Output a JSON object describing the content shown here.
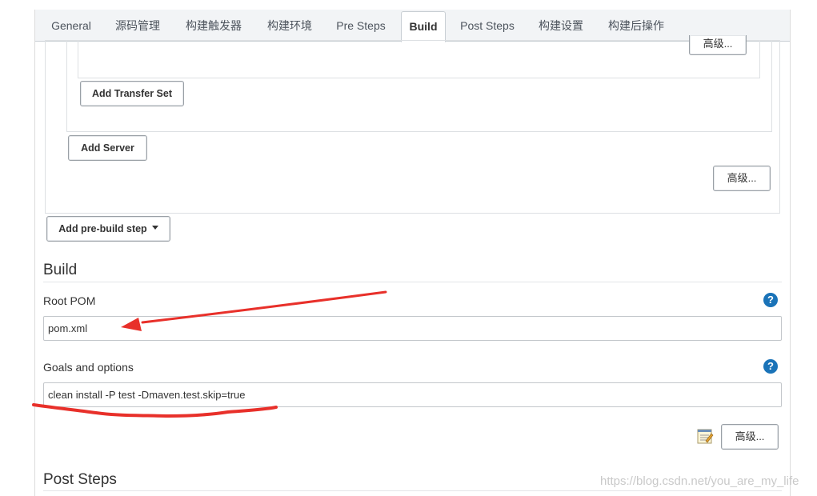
{
  "tabs": [
    {
      "label": "General"
    },
    {
      "label": "源码管理"
    },
    {
      "label": "构建触发器"
    },
    {
      "label": "构建环境"
    },
    {
      "label": "Pre Steps"
    },
    {
      "label": "Build"
    },
    {
      "label": "Post Steps"
    },
    {
      "label": "构建设置"
    },
    {
      "label": "构建后操作"
    }
  ],
  "active_tab": "Build",
  "pre_steps": {
    "advanced_label": "高级...",
    "add_transfer_set_label": "Add Transfer Set",
    "add_server_label": "Add Server",
    "server_advanced_label": "高级...",
    "add_pre_build_step_label": "Add pre-build step"
  },
  "build": {
    "title": "Build",
    "root_pom": {
      "label": "Root POM",
      "value": "pom.xml"
    },
    "goals": {
      "label": "Goals and options",
      "value": "clean install -P test -Dmaven.test.skip=true"
    },
    "advanced_label": "高级...",
    "help_glyph": "?"
  },
  "post_steps": {
    "title": "Post Steps"
  },
  "watermark": "https://blog.csdn.net/you_are_my_life",
  "colors": {
    "annotation_red": "#e8302a",
    "help_blue": "#1a73b8"
  }
}
